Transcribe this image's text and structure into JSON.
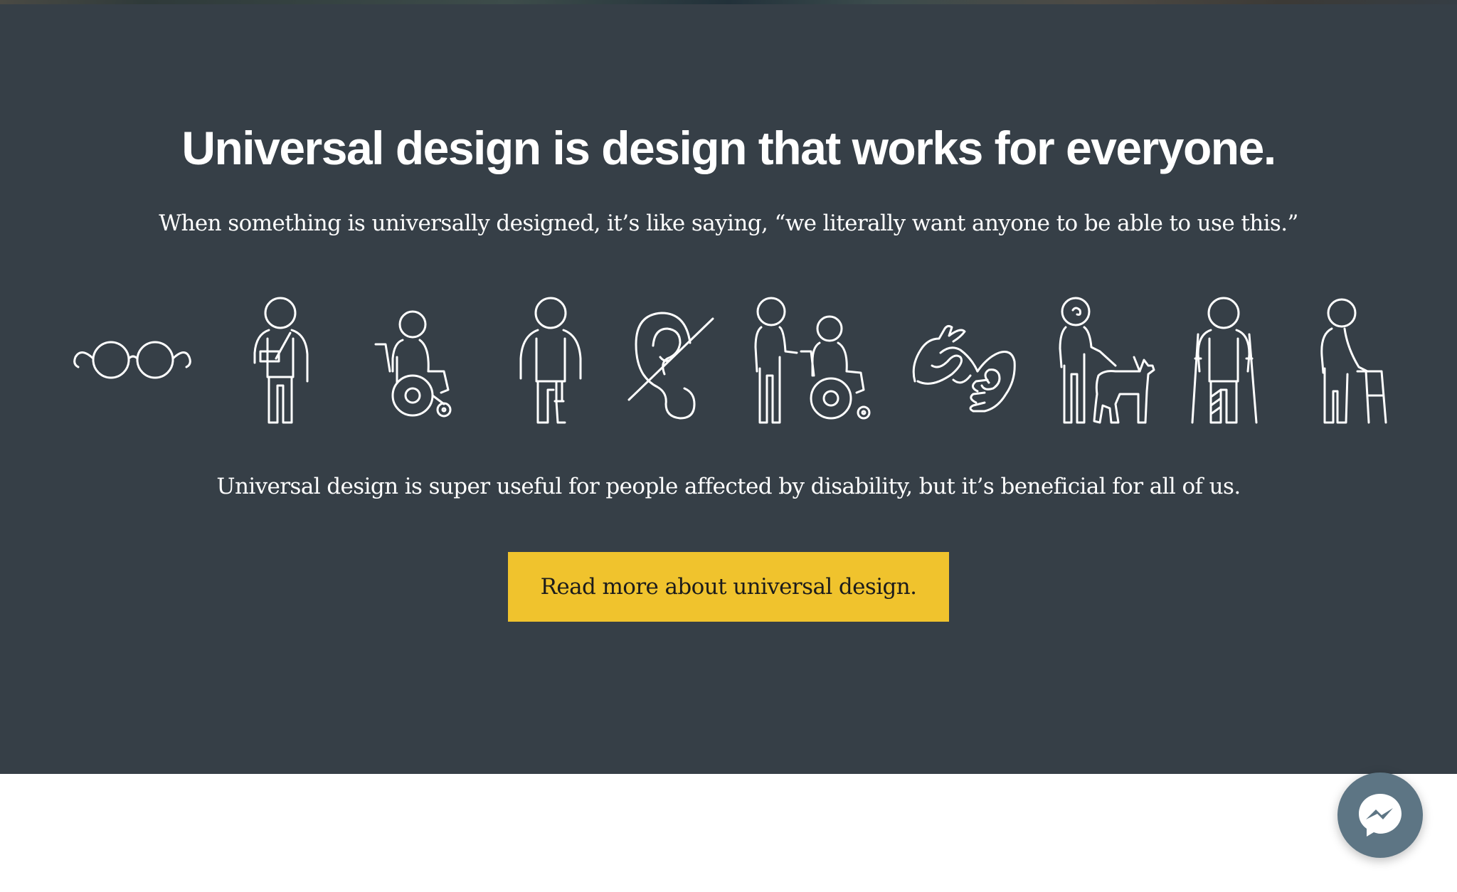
{
  "hero": {
    "headline": "Universal design is design that works for everyone.",
    "subhead": "When something is universally designed, it’s like saying, “we literally want anyone to be able to use this.”",
    "body": "Universal design is super useful for people affected by disability, but it’s beneficial for all of us.",
    "cta_label": "Read more about universal design.",
    "icons": [
      "glasses-icon",
      "arm-sling-person-icon",
      "wheelchair-user-icon",
      "prosthetic-leg-person-icon",
      "deaf-ear-icon",
      "person-helping-wheelchair-user-icon",
      "sign-language-hands-icon",
      "person-with-guide-dog-icon",
      "person-with-crutches-icon",
      "person-with-walker-icon"
    ]
  },
  "messenger": {
    "icon": "messenger-icon"
  },
  "colors": {
    "hero_background": "#363f47",
    "cta_background": "#f0c32d",
    "messenger_background": "#5d7584",
    "text": "#ffffff"
  }
}
